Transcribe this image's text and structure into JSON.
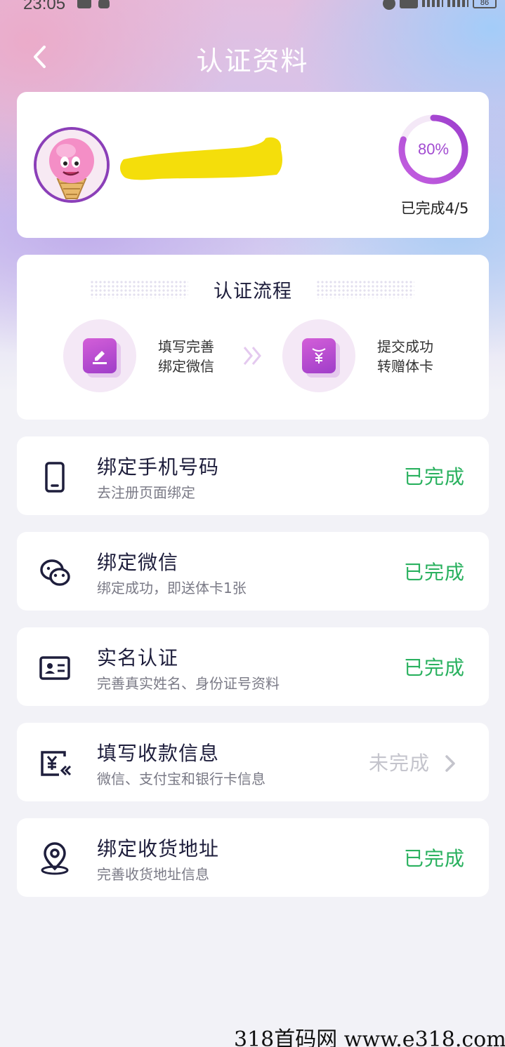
{
  "status_bar": {
    "time": "23:05",
    "battery": "86"
  },
  "header": {
    "title": "认证资料",
    "back_icon": "chevron-left-icon"
  },
  "profile": {
    "progress_percent_text": "80%",
    "progress_fraction": 0.8,
    "progress_label": "已完成4/5",
    "accent_color": "#a24bd1"
  },
  "flow": {
    "title": "认证流程",
    "steps": [
      {
        "line1": "填写完善",
        "line2": "绑定微信",
        "icon": "edit-icon"
      },
      {
        "line1": "提交成功",
        "line2": "转赠体卡",
        "icon": "yuan-bag-icon"
      }
    ]
  },
  "items": [
    {
      "title": "绑定手机号码",
      "subtitle": "去注册页面绑定",
      "status": "已完成",
      "icon": "phone-icon",
      "done": true
    },
    {
      "title": "绑定微信",
      "subtitle": "绑定成功，即送体卡1张",
      "status": "已完成",
      "icon": "wechat-icon",
      "done": true
    },
    {
      "title": "实名认证",
      "subtitle": "完善真实姓名、身份证号资料",
      "status": "已完成",
      "icon": "id-card-icon",
      "done": true
    },
    {
      "title": "填写收款信息",
      "subtitle": "微信、支付宝和银行卡信息",
      "status": "未完成",
      "icon": "payment-icon",
      "done": false
    },
    {
      "title": "绑定收货地址",
      "subtitle": "完善收货地址信息",
      "status": "已完成",
      "icon": "location-icon",
      "done": true
    }
  ],
  "colors": {
    "done": "#2ab15f",
    "pending": "#c4c4cc"
  },
  "watermark": "318首码网   www.e318.com"
}
